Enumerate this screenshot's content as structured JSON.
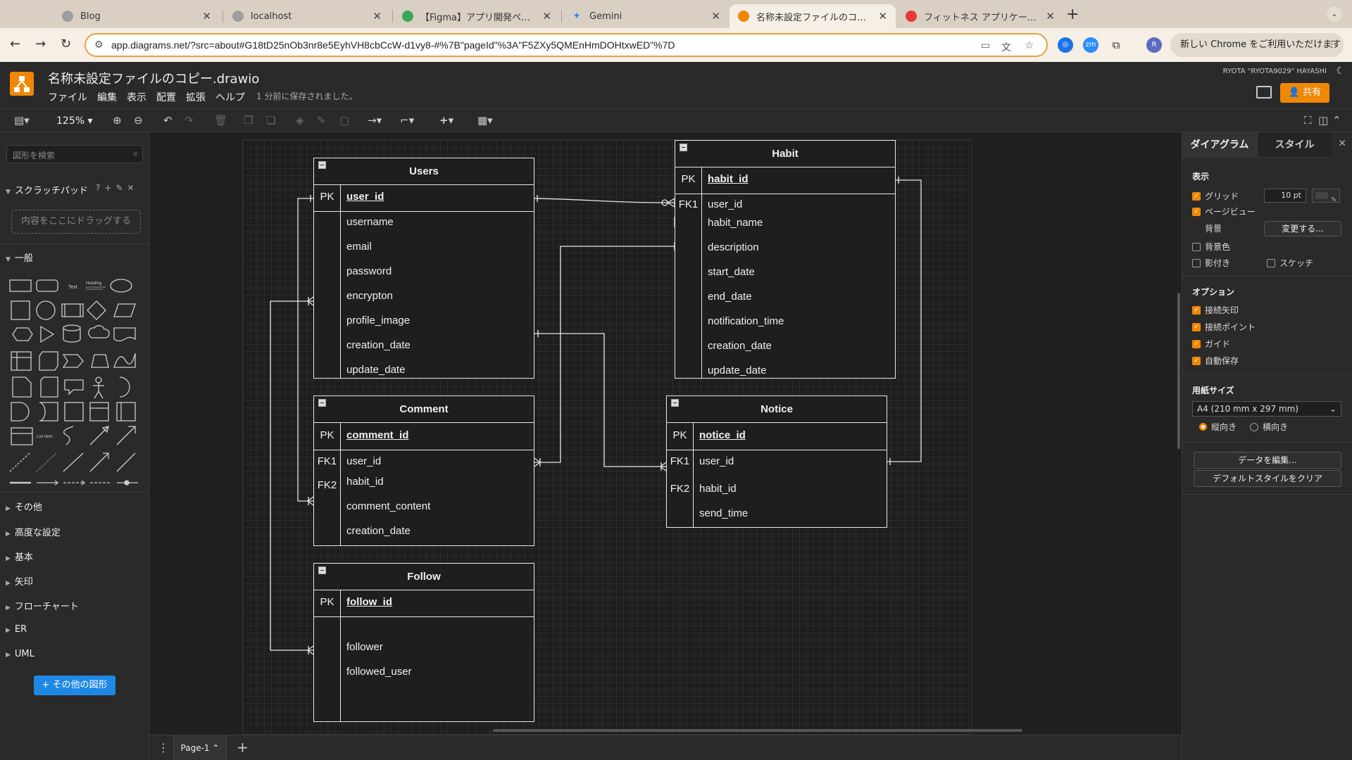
{
  "browser": {
    "tabs": [
      {
        "label": "Blog",
        "color": "#9e9e9e"
      },
      {
        "label": "localhost",
        "color": "#9e9e9e"
      },
      {
        "label": "【Figma】アプリ開発ページ画面",
        "color": "#3aa757"
      },
      {
        "label": "Gemini",
        "color": "#4285f4"
      },
      {
        "label": "名称未設定ファイルのコピー.dra",
        "color": "#f08705"
      },
      {
        "label": "フィットネス アプリケーション",
        "color": "#e53935"
      }
    ],
    "url": "app.diagrams.net/?src=about#G18tD25nOb3nr8e5EyhVH8cbCcW-d1vy8-#%7B\"pageId\"%3A\"F5ZXy5QMEnHmDOHtxwED\"%7D",
    "profile_initial": "R",
    "chrome_promo": "新しい Chrome をご利用いただけます"
  },
  "app": {
    "title": "名称未設定ファイルのコピー.drawio",
    "menu": [
      "ファイル",
      "編集",
      "表示",
      "配置",
      "拡張",
      "ヘルプ"
    ],
    "saved_status": "1 分前に保存されました。",
    "user": "RYOTA \"RYOTA9029\" HAYASHI",
    "share_label": "共有",
    "zoom": "125%",
    "accent": "#f08705"
  },
  "sidebar": {
    "search_placeholder": "図形を検索",
    "scratchpad": "スクラッチパッド",
    "drop_here": "内容をここにドラッグする",
    "general": "一般",
    "sections": [
      "その他",
      "高度な設定",
      "基本",
      "矢印",
      "フローチャート",
      "ER",
      "UML"
    ],
    "more_shapes": "その他の図形"
  },
  "diagram": {
    "tables": {
      "users": {
        "title": "Users",
        "pk_key": "PK",
        "pk": "user_id",
        "fields": [
          "username",
          "email",
          "password",
          "encrypton",
          "profile_image",
          "creation_date",
          "update_date"
        ]
      },
      "habit": {
        "title": "Habit",
        "pk_key": "PK",
        "pk": "habit_id",
        "fk1_key": "FK1",
        "fk1": "user_id",
        "fields": [
          "habit_name",
          "description",
          "start_date",
          "end_date",
          "notification_time",
          "creation_date",
          "update_date"
        ]
      },
      "comment": {
        "title": "Comment",
        "pk_key": "PK",
        "pk": "comment_id",
        "fk1_key": "FK1",
        "fk1": "user_id",
        "fk2_key": "FK2",
        "fk2": "habit_id",
        "fields": [
          "comment_content",
          "creation_date"
        ]
      },
      "notice": {
        "title": "Notice",
        "pk_key": "PK",
        "pk": "notice_id",
        "fk1_key": "FK1",
        "fk1": "user_id",
        "fk2_key": "FK2",
        "fk2": "habit_id",
        "fields": [
          "send_time"
        ]
      },
      "follow": {
        "title": "Follow",
        "pk_key": "PK",
        "pk": "follow_id",
        "fields": [
          "follower",
          "followed_user"
        ]
      }
    }
  },
  "format_panel": {
    "tab_diagram": "ダイアグラム",
    "tab_style": "スタイル",
    "view_heading": "表示",
    "grid": "グリッド",
    "grid_size": "10 pt",
    "page_view": "ページビュー",
    "background": "背景",
    "change": "変更する...",
    "bg_color": "背景色",
    "shadow": "影付き",
    "sketch": "スケッチ",
    "options_heading": "オプション",
    "options": [
      "接続矢印",
      "接続ポイント",
      "ガイド",
      "自動保存"
    ],
    "paper_heading": "用紙サイズ",
    "paper_size": "A4 (210 mm x 297 mm)",
    "portrait": "縦向き",
    "landscape": "横向き",
    "edit_data": "データを編集...",
    "clear_style": "デフォルトスタイルをクリア"
  },
  "footer": {
    "page_tab": "Page-1"
  }
}
